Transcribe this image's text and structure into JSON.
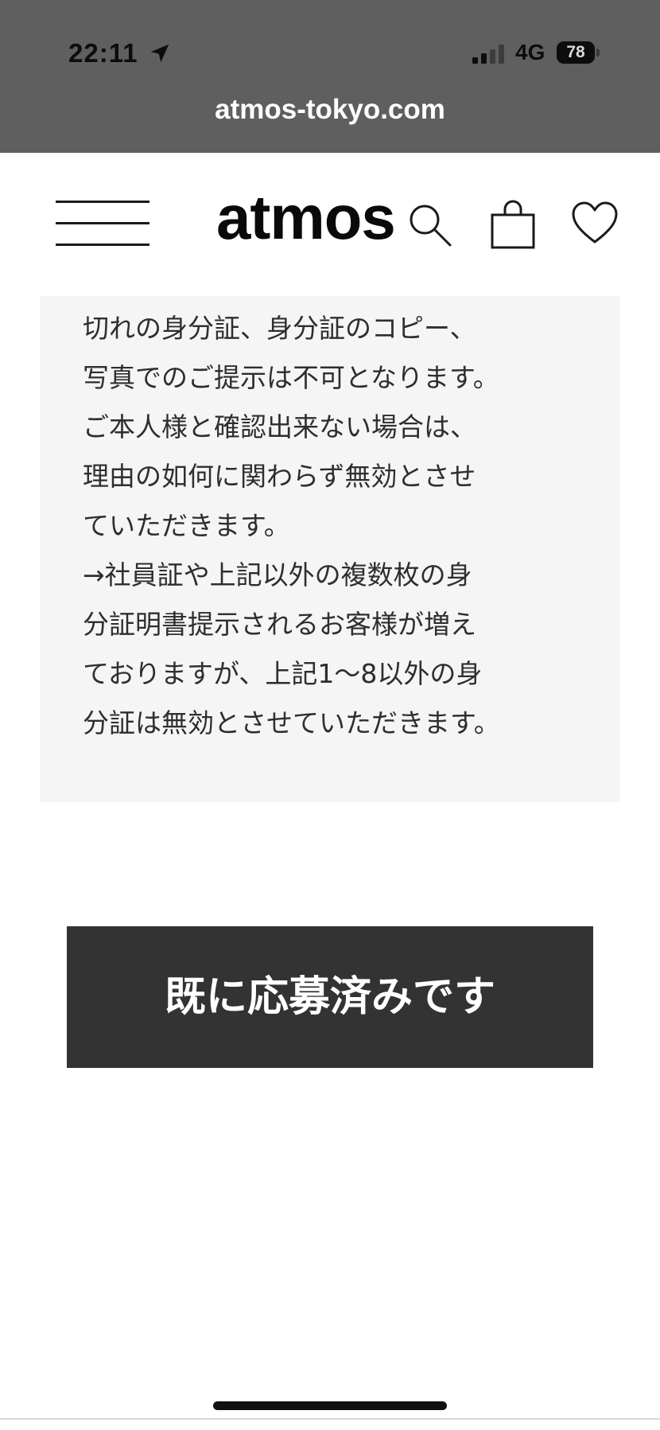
{
  "status_bar": {
    "time": "22:11",
    "network": "4G",
    "battery": "78"
  },
  "browser": {
    "url": "atmos-tokyo.com"
  },
  "header": {
    "logo": "atmos"
  },
  "notice": {
    "lines": [
      "切れの身分証、身分証のコピー、",
      "写真でのご提示は不可となります。",
      "ご本人様と確認出来ない場合は、",
      "理由の如何に関わらず無効とさせ",
      "ていただきます。",
      "→社員証や上記以外の複数枚の身",
      "分証明書提示されるお客様が増え",
      "ておりますが、上記1〜8以外の身",
      "分証は無効とさせていただきます。"
    ]
  },
  "action": {
    "applied_label": "既に応募済みです"
  },
  "icons": {
    "location": "location-arrow-icon",
    "signal": "signal-bars-icon",
    "battery": "battery-icon",
    "menu": "hamburger-menu-icon",
    "search": "search-icon",
    "cart": "shopping-bag-icon",
    "favorite": "heart-icon"
  }
}
